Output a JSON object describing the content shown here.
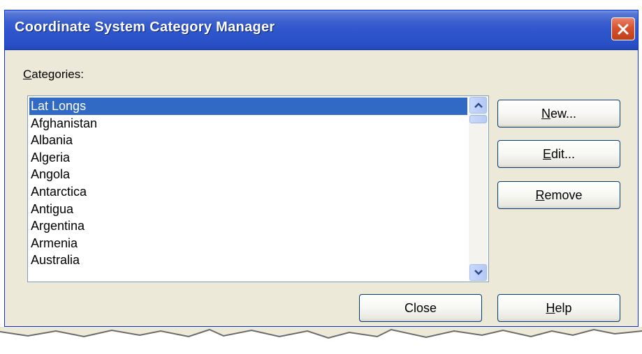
{
  "window": {
    "title": "Coordinate System Category Manager",
    "close_icon": "close-x-icon"
  },
  "categories_label": {
    "mnemonic": "C",
    "rest": "ategories:"
  },
  "list": {
    "selected_index": 0,
    "items": [
      "Lat Longs",
      "Afghanistan",
      "Albania",
      "Algeria",
      "Angola",
      "Antarctica",
      "Antigua",
      "Argentina",
      "Armenia",
      "Australia"
    ]
  },
  "buttons": {
    "new": {
      "mnemonic": "N",
      "rest": "ew..."
    },
    "edit": {
      "mnemonic": "E",
      "rest": "dit..."
    },
    "remove": {
      "mnemonic": "R",
      "rest": "emove"
    },
    "close": {
      "label": "Close"
    },
    "help": {
      "mnemonic": "H",
      "rest": "elp"
    }
  },
  "colors": {
    "titlebar": "#2a50c6",
    "dialog_bg": "#ece9d8",
    "selection": "#316ac5",
    "close_button": "#d6532f"
  }
}
